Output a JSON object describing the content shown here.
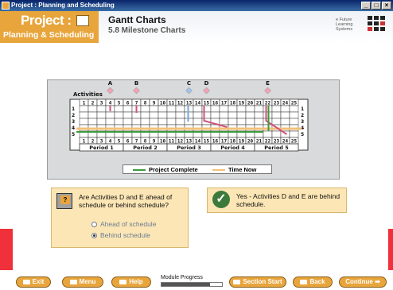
{
  "window": {
    "title": "Project : Planning and Scheduling",
    "min_icon": "minimize-icon",
    "max_icon": "maximize-icon",
    "close_icon": "close-icon"
  },
  "header": {
    "logo_title": "Project :",
    "logo_subtitle": "Planning & Scheduling",
    "title": "Gantt Charts",
    "subtitle": "5.8 Milestone Charts",
    "brand_lines": [
      "e Future",
      "Learning",
      "Systems"
    ]
  },
  "chart": {
    "activities_label": "Activities",
    "milestones": [
      {
        "label": "A",
        "week": 4,
        "color": "#f2a3b7"
      },
      {
        "label": "B",
        "week": 7,
        "color": "#f2a3b7"
      },
      {
        "label": "C",
        "week": 13,
        "color": "#9fc4ea"
      },
      {
        "label": "D",
        "week": 15,
        "color": "#f2a3b7"
      },
      {
        "label": "E",
        "week": 22,
        "color": "#f2a3b7"
      }
    ],
    "weeks": [
      "1",
      "2",
      "3",
      "4",
      "5",
      "6",
      "7",
      "8",
      "9",
      "10",
      "11",
      "12",
      "13",
      "14",
      "15",
      "16",
      "17",
      "18",
      "19",
      "20",
      "21",
      "22",
      "23",
      "24",
      "25"
    ],
    "rows": [
      "1",
      "2",
      "3",
      "4",
      "5"
    ],
    "periods": [
      "Period 1",
      "Period 2",
      "Period 3",
      "Period 4",
      "Period 5"
    ],
    "time_now_week": 21,
    "colors": {
      "project_complete": "#3c9a3c",
      "time_now": "#f2c07a",
      "milestone_pink": "#f2a3b7",
      "milestone_blue": "#9fc4ea",
      "dependency": "#d0517a"
    }
  },
  "legend": {
    "project_complete": "Project Complete",
    "time_now": "Time Now"
  },
  "question": {
    "icon": "question-icon",
    "text": "Are Activities D and E ahead of schedule or behind schedule?",
    "options": [
      "Ahead of schedule",
      "Behind schedule"
    ],
    "selected": "Behind schedule"
  },
  "answer": {
    "icon": "check-icon",
    "text": "Yes - Activities D and E are behind schedule."
  },
  "footer": {
    "exit": "Exit",
    "menu": "Menu",
    "help": "Help",
    "progress_label": "Module Progress",
    "progress": 0.8,
    "section_start": "Section Start",
    "back": "Back",
    "continue": "Continue"
  }
}
